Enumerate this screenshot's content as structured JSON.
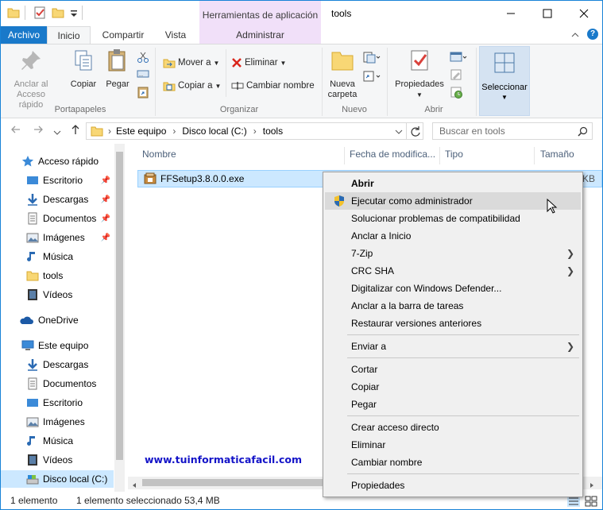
{
  "titlebar": {
    "context_tab_header": "Herramientas de aplicación",
    "title": "tools",
    "minimize": "—",
    "maximize": "☐",
    "close": "✕"
  },
  "tabs": {
    "file": "Archivo",
    "items": [
      "Inicio",
      "Compartir",
      "Vista",
      "Administrar"
    ],
    "active": "Inicio"
  },
  "ribbon": {
    "groups": {
      "clipboard": "Portapapeles",
      "organize": "Organizar",
      "new": "Nuevo",
      "open": "Abrir"
    },
    "pin_quick_access": "Anclar al\nAcceso rápido",
    "pin_line1": "Anclar al",
    "pin_line2": "Acceso rápido",
    "copy": "Copiar",
    "paste": "Pegar",
    "move_to": "Mover a",
    "copy_to": "Copiar a",
    "delete": "Eliminar",
    "rename": "Cambiar nombre",
    "new_folder_1": "Nueva",
    "new_folder_2": "carpeta",
    "properties": "Propiedades",
    "select": "Seleccionar"
  },
  "address": {
    "crumbs": [
      "Este equipo",
      "Disco local (C:)",
      "tools"
    ],
    "search_placeholder": "Buscar en tools"
  },
  "nav": {
    "quick_access": "Acceso rápido",
    "quick_items": [
      {
        "label": "Escritorio",
        "pinned": true
      },
      {
        "label": "Descargas",
        "pinned": true
      },
      {
        "label": "Documentos",
        "pinned": true
      },
      {
        "label": "Imágenes",
        "pinned": true
      },
      {
        "label": "Música",
        "pinned": false
      },
      {
        "label": "tools",
        "pinned": false
      },
      {
        "label": "Vídeos",
        "pinned": false
      }
    ],
    "onedrive": "OneDrive",
    "this_pc": "Este equipo",
    "pc_items": [
      "Descargas",
      "Documentos",
      "Escritorio",
      "Imágenes",
      "Música",
      "Vídeos",
      "Disco local (C:)"
    ]
  },
  "files": {
    "columns": [
      "Nombre",
      "Fecha de modifica...",
      "Tipo",
      "Tamaño"
    ],
    "rows": [
      {
        "name": "FFSetup3.8.0.0.exe",
        "size_partial": "KB"
      }
    ]
  },
  "context_menu": {
    "items": [
      {
        "label": "Abrir",
        "bold": true
      },
      {
        "label": "Ejecutar como administrador",
        "shield": true
      },
      {
        "label": "Solucionar problemas de compatibilidad"
      },
      {
        "label": "Anclar a Inicio"
      },
      {
        "label": "7-Zip",
        "submenu": true
      },
      {
        "label": "CRC SHA",
        "submenu": true
      },
      {
        "label": "Digitalizar con Windows Defender..."
      },
      {
        "label": "Anclar a la barra de tareas"
      },
      {
        "label": "Restaurar versiones anteriores"
      },
      {
        "label": "Enviar a",
        "submenu": true
      },
      {
        "label": "Cortar"
      },
      {
        "label": "Copiar"
      },
      {
        "label": "Pegar"
      },
      {
        "label": "Crear acceso directo"
      },
      {
        "label": "Eliminar"
      },
      {
        "label": "Cambiar nombre"
      },
      {
        "label": "Propiedades"
      }
    ],
    "hovered": "Ejecutar como administrador"
  },
  "watermark": "www.tuinformaticafacil.com",
  "status": {
    "count": "1 elemento",
    "selected": "1 elemento seleccionado  53,4 MB"
  },
  "colors": {
    "accent": "#1979ca",
    "contextual_tab": "#f1e0f9",
    "selection": "#cce8ff",
    "watermark": "#1414c8"
  }
}
